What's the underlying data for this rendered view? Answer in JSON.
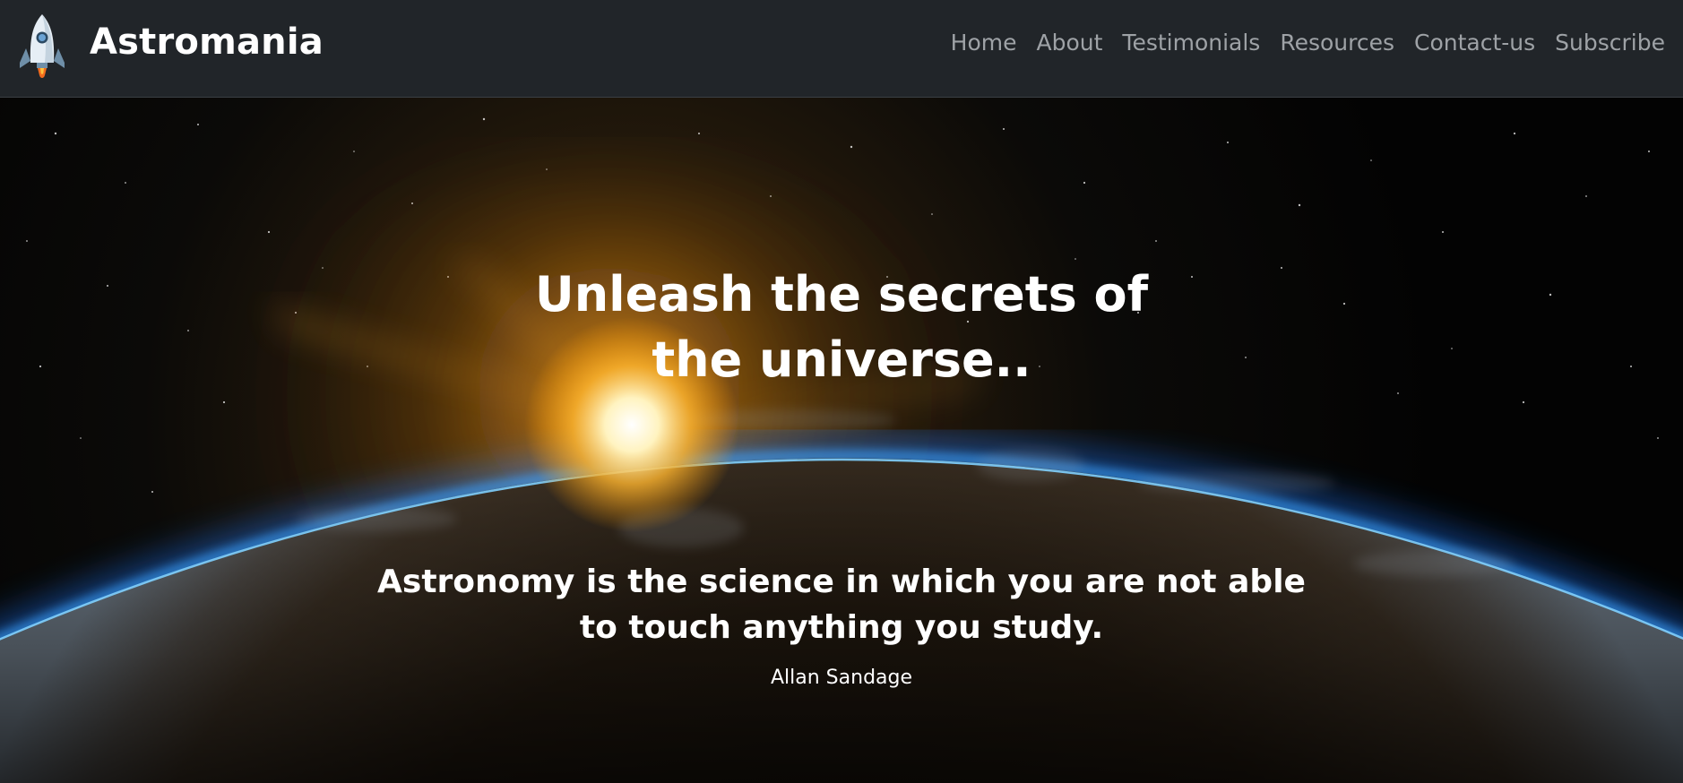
{
  "navbar": {
    "brand_icon": "rocket-icon",
    "brand_name": "Astromania",
    "links": [
      {
        "label": "Home"
      },
      {
        "label": "About"
      },
      {
        "label": "Testimonials"
      },
      {
        "label": "Resources"
      },
      {
        "label": "Contact-us"
      },
      {
        "label": "Subscribe"
      }
    ]
  },
  "hero": {
    "headline_line1": "Unleash the secrets of",
    "headline_line2": "the universe..",
    "quote_line1": "Astronomy is the science in which you are not able",
    "quote_line2": "to touch anything you study.",
    "author": "Allan Sandage"
  },
  "colors": {
    "navbar_bg": "#212529",
    "nav_link": "#9ea2a6",
    "brand_text": "#ffffff",
    "atmosphere_glow": "#1e90ff",
    "sun_glow": "#ffb020"
  }
}
